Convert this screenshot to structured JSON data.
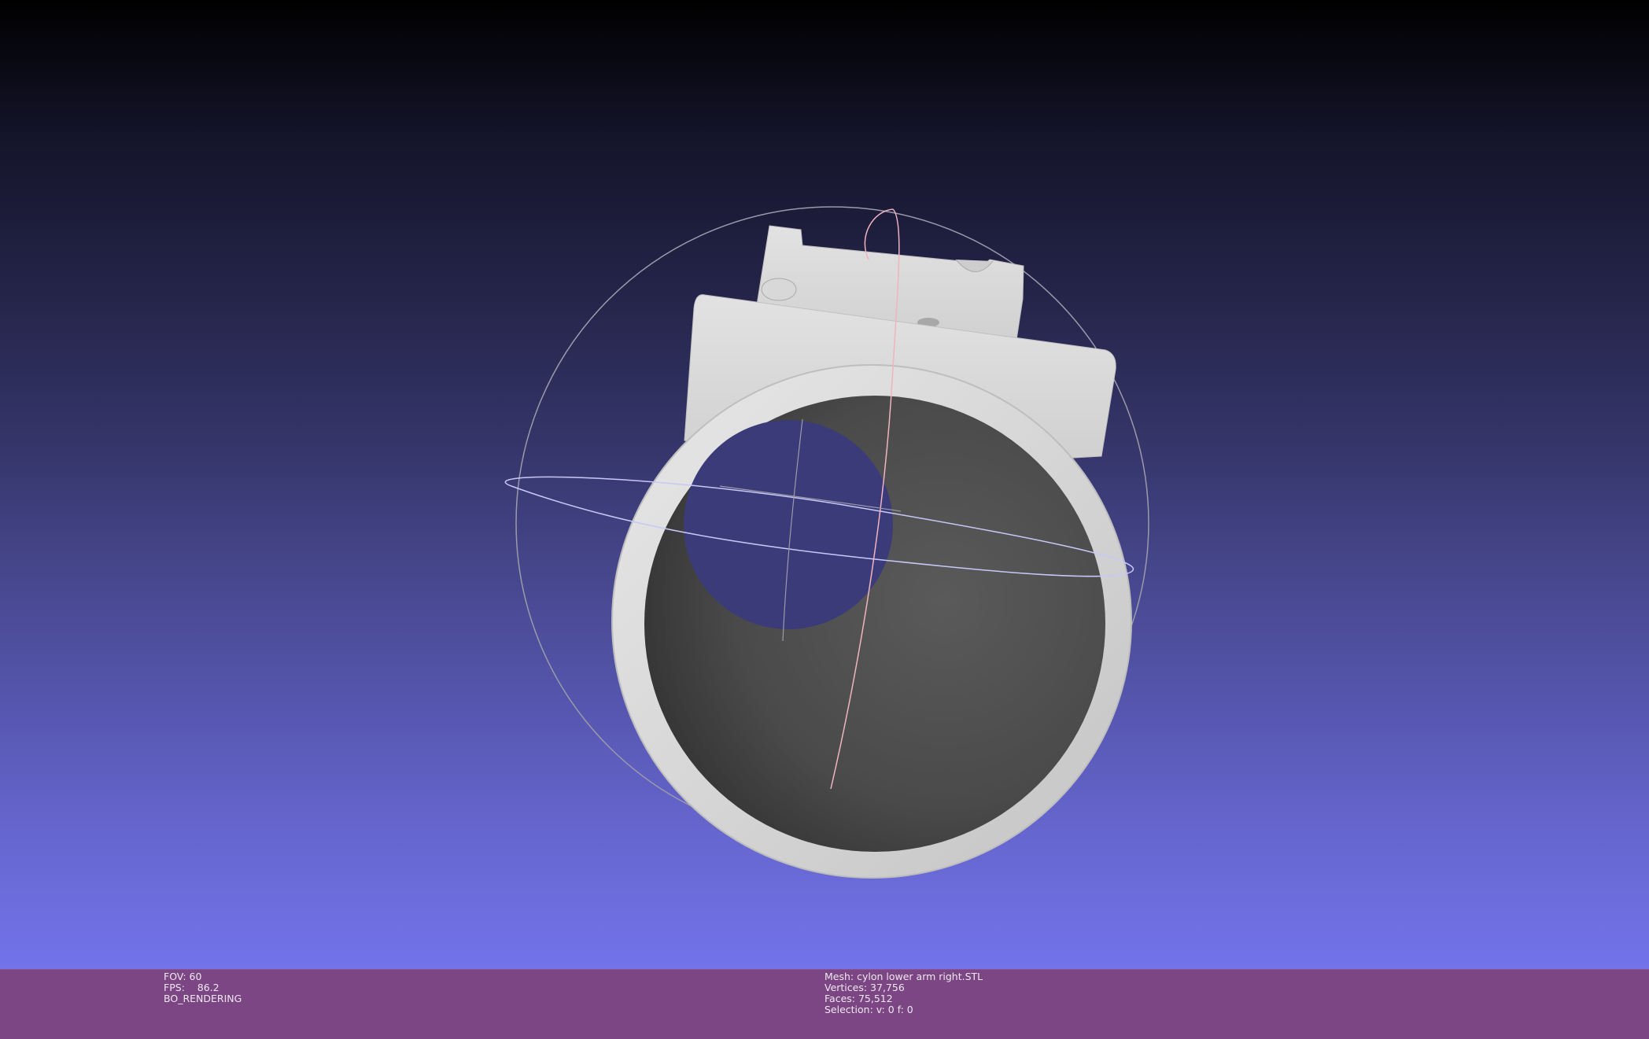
{
  "viewport": {
    "model": "mesh-model",
    "trackball": "trackball-gizmo"
  },
  "status_left": {
    "fov": "FOV: 60",
    "fps": "FPS:    86.2",
    "mode": "BO_RENDERING"
  },
  "status_right": {
    "mesh": "Mesh: cylon lower arm right.STL",
    "vertices": "Vertices: 37,756",
    "faces": "Faces: 75,512",
    "selection": "Selection: v: 0 f: 0"
  },
  "colors": {
    "background_top": "#000000",
    "background_bottom": "#7373ea",
    "statusbar": "#7b4683",
    "mesh": "#d9d9d9",
    "trackball_ring_gray": "#9a9aaa",
    "trackball_ring_pink": "#f0b4c0",
    "trackball_ring_blue": "#c8c8f8"
  }
}
